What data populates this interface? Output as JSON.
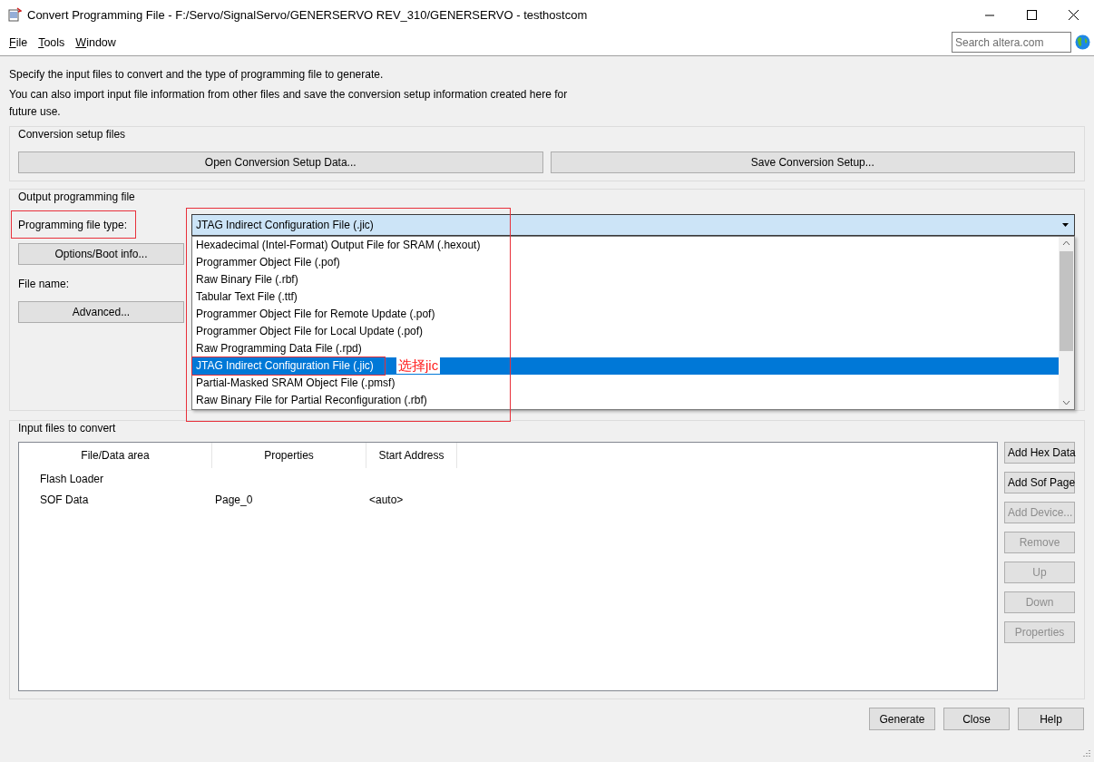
{
  "window": {
    "title": "Convert Programming File - F:/Servo/SignalServo/GENERSERVO REV_310/GENERSERVO - testhostcom"
  },
  "menu": [
    "File",
    "Tools",
    "Window"
  ],
  "search": {
    "placeholder": "Search altera.com"
  },
  "description": [
    "Specify the input files to convert and the type of programming file to generate.",
    "You can also import input file information from other files and save the conversion setup information created here for future use."
  ],
  "conversion_setup": {
    "title": "Conversion setup files",
    "buttons": [
      "Open Conversion Setup Data...",
      "Save Conversion Setup..."
    ]
  },
  "output": {
    "title": "Output programming file",
    "type_label": "Programming file type:",
    "type_value": "JTAG Indirect Configuration File (.jic)",
    "options_button": "Options/Boot info...",
    "file_name_label": "File name:",
    "advanced_button": "Advanced...",
    "options": [
      {
        "label": "Hexadecimal (Intel-Format) Output File for SRAM (.hexout)",
        "selected": false
      },
      {
        "label": "Programmer Object File (.pof)",
        "selected": false
      },
      {
        "label": "Raw Binary File (.rbf)",
        "selected": false
      },
      {
        "label": "Tabular Text File (.ttf)",
        "selected": false
      },
      {
        "label": "Programmer Object File for Remote Update (.pof)",
        "selected": false
      },
      {
        "label": "Programmer Object File for Local Update (.pof)",
        "selected": false
      },
      {
        "label": "Raw Programming Data File (.rpd)",
        "selected": false
      },
      {
        "label": "JTAG Indirect Configuration File (.jic)",
        "selected": true
      },
      {
        "label": "Partial-Masked SRAM Object File (.pmsf)",
        "selected": false
      },
      {
        "label": "Raw Binary File for Partial Reconfiguration (.rbf)",
        "selected": false
      }
    ]
  },
  "input": {
    "title": "Input files to convert",
    "columns": [
      "File/Data area",
      "Properties",
      "Start Address"
    ],
    "rows": [
      {
        "name": "Flash Loader"
      },
      {
        "name": "SOF Data",
        "properties": "Page_0",
        "start_address": "<auto>"
      }
    ],
    "buttons": [
      {
        "label": "Add Hex Data",
        "disabled": false
      },
      {
        "label": "Add Sof Page",
        "disabled": false
      },
      {
        "label": "Add Device...",
        "disabled": true
      },
      {
        "label": "Remove",
        "disabled": true
      },
      {
        "label": "Up",
        "disabled": true
      },
      {
        "label": "Down",
        "disabled": true
      },
      {
        "label": "Properties",
        "disabled": true
      }
    ]
  },
  "footer_buttons": [
    "Generate",
    "Close",
    "Help"
  ],
  "annotation": {
    "note": "选择jic"
  }
}
